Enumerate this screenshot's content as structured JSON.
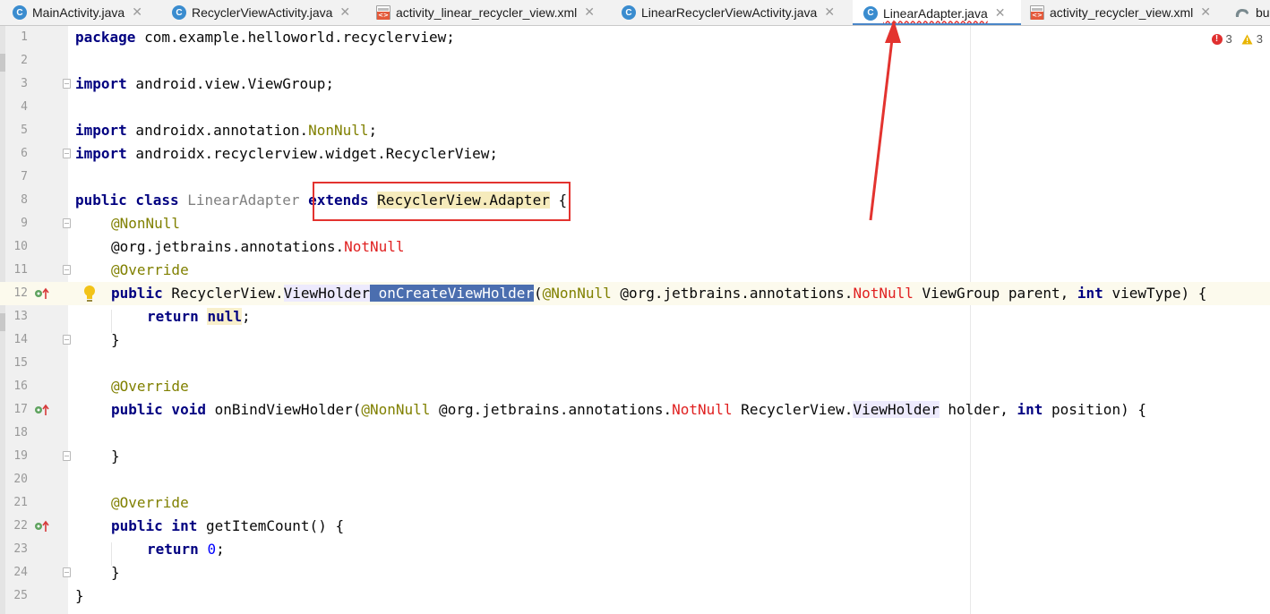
{
  "tabs": [
    {
      "label": "MainActivity.java",
      "icon": "java-class-icon",
      "active": false
    },
    {
      "label": "RecyclerViewActivity.java",
      "icon": "java-class-icon",
      "active": false
    },
    {
      "label": "activity_linear_recycler_view.xml",
      "icon": "xml-layout-icon",
      "active": false
    },
    {
      "label": "LinearRecyclerViewActivity.java",
      "icon": "java-class-icon",
      "active": false
    },
    {
      "label": "LinearAdapter.java",
      "icon": "java-class-icon",
      "active": true
    },
    {
      "label": "activity_recycler_view.xml",
      "icon": "xml-layout-icon",
      "active": false
    },
    {
      "label": "bu",
      "icon": "gradle-icon",
      "active": false
    }
  ],
  "tab_close_glyph": "✕",
  "class_icon_glyph": "C",
  "inspection": {
    "errors": "3",
    "warnings": "3"
  },
  "line_numbers": [
    "1",
    "2",
    "3",
    "4",
    "5",
    "6",
    "7",
    "8",
    "9",
    "10",
    "11",
    "12",
    "13",
    "14",
    "15",
    "16",
    "17",
    "18",
    "19",
    "20",
    "21",
    "22",
    "23",
    "24",
    "25"
  ],
  "code": {
    "l1_kw": "package",
    "l1_rest": " com.example.helloworld.recyclerview;",
    "l3_kw": "import",
    "l3_rest": " android.view.ViewGroup;",
    "l5_kw": "import",
    "l5_a": " androidx.annotation.",
    "l5_b": "NonNull",
    "l5_c": ";",
    "l6_kw": "import",
    "l6_rest": " androidx.recyclerview.widget.RecyclerView;",
    "l8_kw": "public class",
    "l8_name": " LinearAdapter ",
    "l8_ext": "extends",
    "l8_sp": " ",
    "l8_super": "RecyclerView.Adapter",
    "l8_end": " {",
    "l9": "@NonNull",
    "l10_a": "@org.jetbrains.annotations.",
    "l10_b": "NotNull",
    "l11": "@Override",
    "l12_kw": "public",
    "l12_a": " RecyclerView.",
    "l12_vh": "ViewHolder",
    "l12_sp": " ",
    "l12_m": "onCreateViewHolder",
    "l12_p": "(",
    "l12_ann": "@NonNull",
    "l12_b": " @org.jetbrains.annotations.",
    "l12_nn": "NotNull",
    "l12_c": " ViewGroup parent, ",
    "l12_int": "int",
    "l12_d": " viewType) {",
    "l13_kw": "return",
    "l13_sp": " ",
    "l13_null": "null",
    "l13_end": ";",
    "l14": "}",
    "l16": "@Override",
    "l17_kw": "public void",
    "l17_a": " onBindViewHolder(",
    "l17_ann": "@NonNull",
    "l17_b": " @org.jetbrains.annotations.",
    "l17_nn": "NotNull",
    "l17_c": " RecyclerView.",
    "l17_vh": "ViewHolder",
    "l17_d": " holder, ",
    "l17_int": "int",
    "l17_e": " position) {",
    "l19": "}",
    "l21": "@Override",
    "l22_kw": "public int",
    "l22_rest": " getItemCount() {",
    "l23_kw": "return",
    "l23_sp": " ",
    "l23_num": "0",
    "l23_end": ";",
    "l24": "}",
    "l25": "}"
  }
}
